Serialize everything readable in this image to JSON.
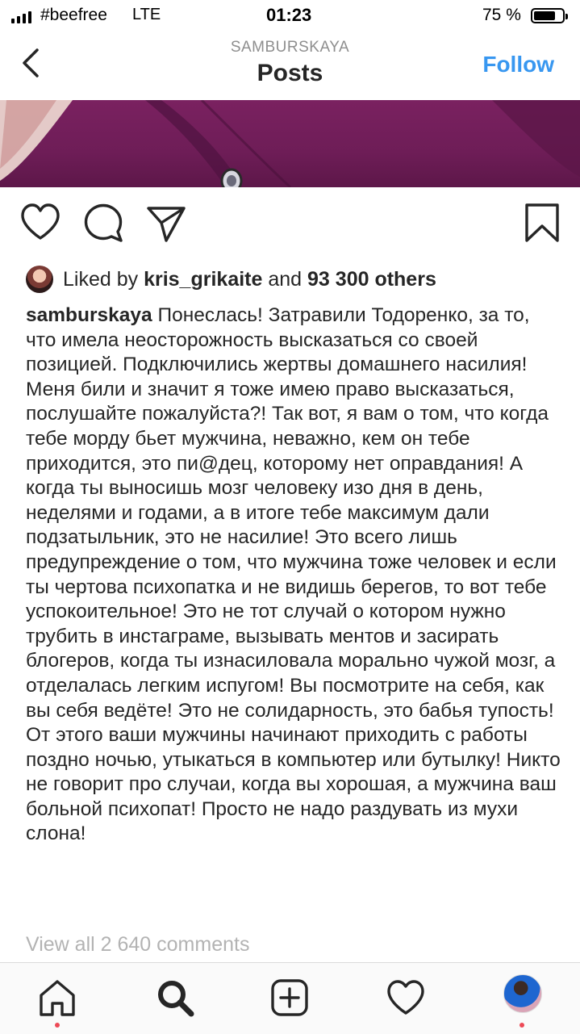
{
  "status_bar": {
    "carrier": "#beefree",
    "network": "LTE",
    "time": "01:23",
    "battery_percent": "75 %",
    "battery_level": 0.75
  },
  "header": {
    "username": "SAMBURSKAYA",
    "title": "Posts",
    "follow_label": "Follow",
    "follow_color": "#3897f0"
  },
  "actions": {
    "icons": [
      "heart-icon",
      "comment-icon",
      "share-icon",
      "bookmark-icon"
    ]
  },
  "likes": {
    "prefix": "Liked by",
    "liker": "kris_grikaite",
    "connector": "and",
    "others": "93 300 others"
  },
  "caption": {
    "author": "samburskaya",
    "text": "Понеслась! Затравили Тодоренко, за то, что имела неосторожность высказаться со своей позицией. Подключились жертвы домашнего насилия! Меня били и значит я тоже имею право высказаться,  послушайте пожалуйста?! Так вот, я вам о том, что когда тебе морду бьет мужчина, неважно, кем он тебе приходится, это пи@дец, которому нет оправдания! А когда ты выносишь мозг человеку изо дня в день, неделями и годами, а в итоге тебе максимум дали подзатыльник, это не насилие! Это всего лишь предупреждение о том, что мужчина тоже человек и если ты чертова психопатка и не видишь берегов, то вот тебе успокоительное! Это не тот случай о котором нужно трубить в инстаграме, вызывать ментов и засирать блогеров, когда ты изнасиловала морально чужой мозг, а отделалась легким испугом! Вы посмотрите на себя, как вы себя ведёте! Это не солидарность, это бабья тупость! От этого ваши мужчины начинают приходить с работы поздно ночью, утыкаться в компьютер или бутылку! Никто не говорит про случаи, когда вы хорошая, а мужчина ваш больной психопат! Просто не надо раздувать из мухи слона!"
  },
  "comments_link": "View all 2 640 comments",
  "tab_bar": {
    "items": [
      "home-icon",
      "search-icon",
      "new-post-icon",
      "activity-icon",
      "profile-avatar"
    ],
    "notification_color": "#ed4956"
  }
}
